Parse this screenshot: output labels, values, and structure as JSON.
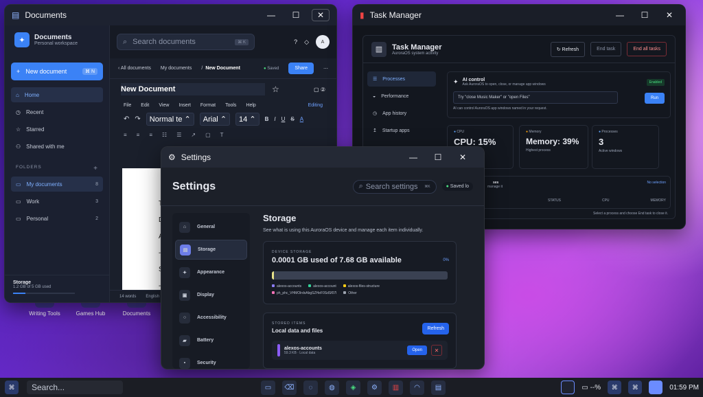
{
  "documents": {
    "window_title": "Documents",
    "brand_title": "Documents",
    "brand_subtitle": "Personal workspace",
    "search_placeholder": "Search documents",
    "search_kbd": "⌘ K",
    "avatar": "A",
    "new_document": "New document",
    "new_document_kbd": "⌘ N",
    "nav": [
      {
        "label": "Home"
      },
      {
        "label": "Recent"
      },
      {
        "label": "Starred"
      },
      {
        "label": "Shared with me"
      }
    ],
    "folders_label": "FOLDERS",
    "folders": [
      {
        "label": "My documents",
        "count": "8"
      },
      {
        "label": "Work",
        "count": "3"
      },
      {
        "label": "Personal",
        "count": "2"
      }
    ],
    "storage_title": "Storage",
    "storage_sub": "1.2 GB of 5 GB used",
    "crumb_back": "All documents",
    "crumb_folder": "My documents",
    "crumb_sep": "/",
    "crumb_current": "New Document",
    "saved": "Saved",
    "share": "Share",
    "doc_title": "New Document",
    "menus": [
      "File",
      "Edit",
      "View",
      "Insert",
      "Format",
      "Tools",
      "Help"
    ],
    "editing": "Editing",
    "style_select": "Normal te",
    "font_select": "Arial",
    "size_select": "14",
    "paper_lines": [
      "Ti",
      "Da",
      "Au",
      "--",
      "St",
      "-"
    ],
    "words": "14 words",
    "lang": "English (U"
  },
  "task_manager": {
    "window_title": "Task Manager",
    "title": "Task Manager",
    "subtitle": "AuroraOS system activity",
    "refresh": "Refresh",
    "end_task": "End task",
    "end_all": "End all tasks",
    "nav": [
      {
        "label": "Processes"
      },
      {
        "label": "Performance"
      },
      {
        "label": "App history"
      },
      {
        "label": "Startup apps"
      }
    ],
    "ai_title": "AI control",
    "ai_sub": "Ask AuroraOS to open, close, or manage app windows",
    "ai_enabled": "Enabled",
    "ai_placeholder": "Try \"close Music Maker\" or \"open Files\"",
    "ai_run": "Run",
    "ai_note": "AI can control AuroraOS app windows named in your request.",
    "cpu_label": "CPU",
    "cpu_value": "CPU: 15%",
    "mem_label": "Memory",
    "mem_value": "Memory: 39%",
    "mem_sub": "Highest process",
    "proc_label": "Processes",
    "proc_value": "3",
    "proc_sub": "Active windows",
    "proc_head": "ses",
    "proc_head_sub": "manage it",
    "no_selection": "No selection",
    "col_status": "STATUS",
    "col_cpu": "CPU",
    "col_memory": "MEMORY",
    "footer": "Select a process and choose End task to close it."
  },
  "settings": {
    "window_title": "Settings",
    "heading": "Settings",
    "search_placeholder": "Search settings",
    "search_kbd": "⌘K",
    "saved": "Saved lo",
    "nav": [
      {
        "label": "General"
      },
      {
        "label": "Storage"
      },
      {
        "label": "Appearance"
      },
      {
        "label": "Display"
      },
      {
        "label": "Accessibility"
      },
      {
        "label": "Battery"
      },
      {
        "label": "Security"
      }
    ],
    "page_title": "Storage",
    "page_desc": "See what is using this AuroraOS device and manage each item individually.",
    "device_label": "DEVICE STORAGE",
    "device_used": "0.0001 GB used of 7.68 GB available",
    "device_pct": "0%",
    "device_fill": 0.012,
    "legend": [
      {
        "label": "alexos-accounts",
        "color": "#8b7cf6"
      },
      {
        "label": "alexos-account",
        "color": "#34d399"
      },
      {
        "label": "alexos-files-structure",
        "color": "#facc15"
      },
      {
        "label": "ph_phc_VHMOlrdxAbgSZHeF0SdSf07l",
        "color": "#f472b6"
      },
      {
        "label": "Other",
        "color": "#9ca3af"
      }
    ],
    "stored_label": "STORED ITEMS",
    "stored_title": "Local data and files",
    "refresh": "Refresh",
    "item_name": "alexos-accounts",
    "item_meta": "59.3 KB · Local data",
    "open": "Open"
  },
  "desktop_icons": [
    {
      "label": "Writing Tools"
    },
    {
      "label": "Games Hub"
    },
    {
      "label": "Documents"
    }
  ],
  "taskbar": {
    "search_placeholder": "Search...",
    "battery": "--%",
    "time": "01:59 PM"
  }
}
